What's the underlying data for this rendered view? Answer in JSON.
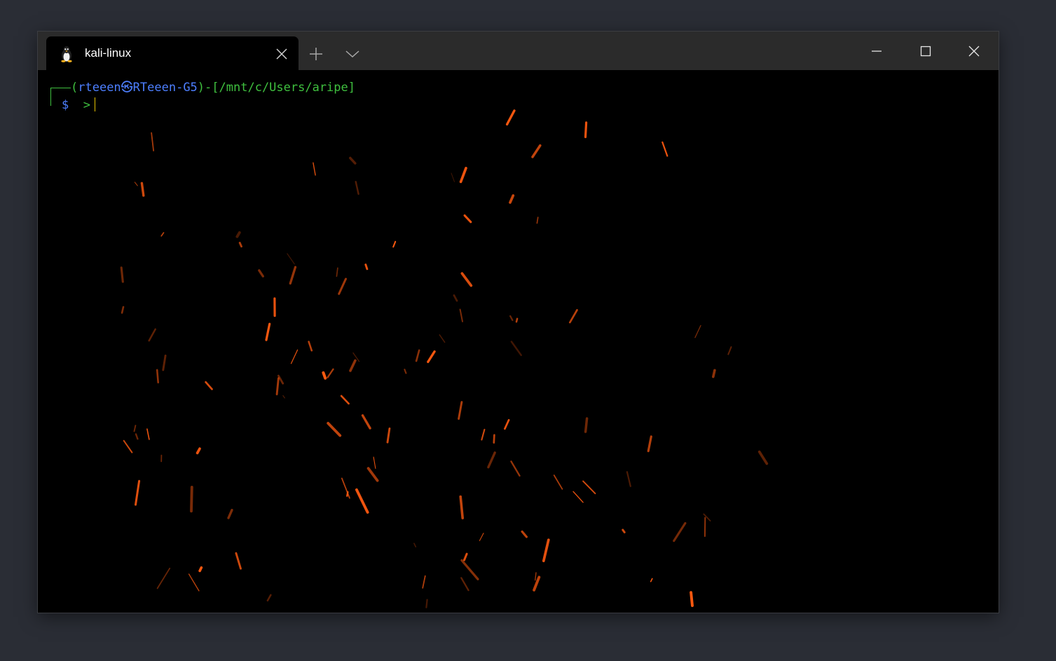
{
  "window": {
    "tab_title": "kali-linux",
    "tab_icon": "linux-penguin-icon"
  },
  "prompt": {
    "open_paren": "(",
    "user": "rteeen",
    "at_symbol": "㉿",
    "host": "RTeeen-G5",
    "close_paren": ")",
    "dash": "-",
    "path": "[/mnt/c/Users/aripe]",
    "dollar": "$",
    "arrow": ">"
  },
  "colors": {
    "prompt_green": "#3fc03f",
    "prompt_blue": "#4d7fff",
    "cursor_yellow": "#e5c200",
    "spark_orange": "#ff5a10",
    "terminal_bg": "#000000",
    "titlebar_bg": "#2b2b2b"
  }
}
